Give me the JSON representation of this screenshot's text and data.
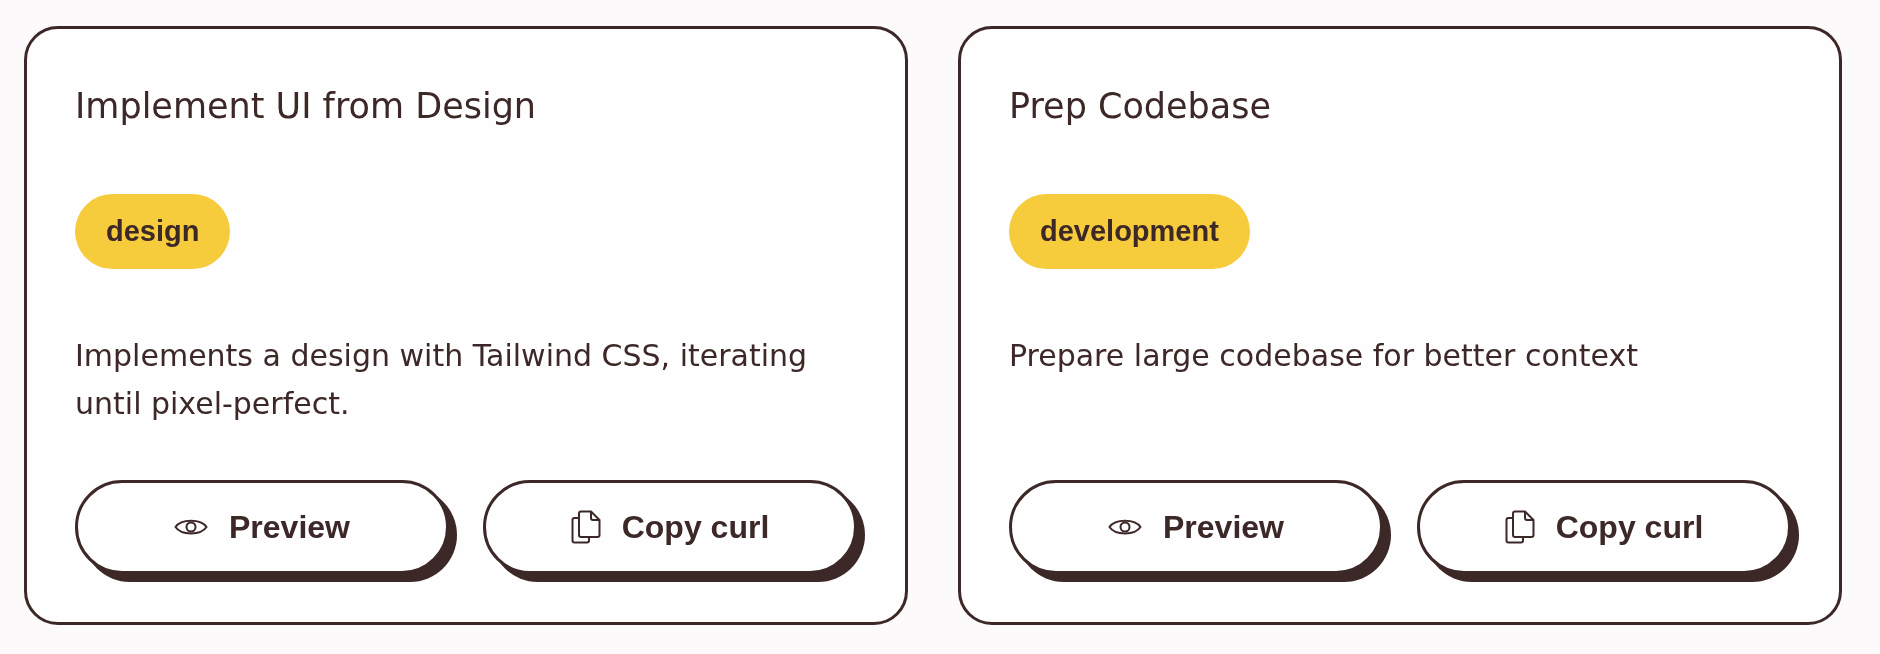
{
  "cards": [
    {
      "title": "Implement UI from Design",
      "tag": "design",
      "description": "Implements a design with Tailwind CSS, iterating until pixel-perfect.",
      "buttons": [
        {
          "kind": "preview",
          "label": "Preview"
        },
        {
          "kind": "copy",
          "label": "Copy curl"
        }
      ]
    },
    {
      "title": "Prep Codebase",
      "tag": "development",
      "description": "Prepare large codebase for better context",
      "buttons": [
        {
          "kind": "preview",
          "label": "Preview"
        },
        {
          "kind": "copy",
          "label": "Copy curl"
        }
      ]
    }
  ]
}
